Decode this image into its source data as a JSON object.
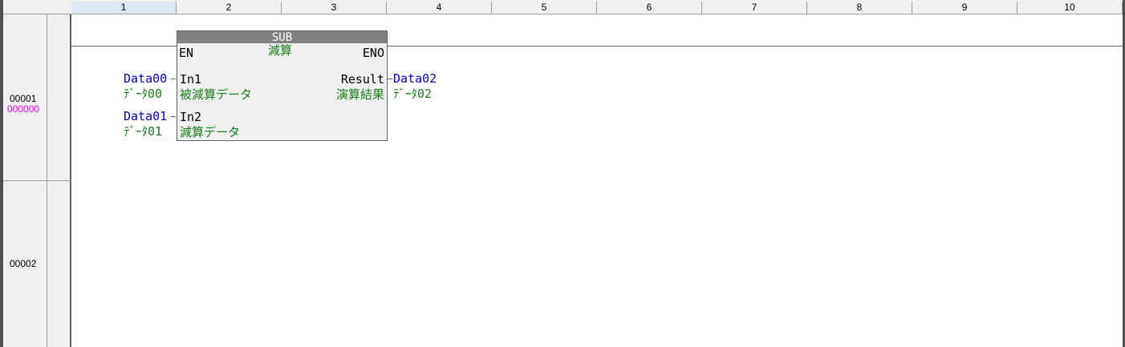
{
  "columns": [
    "1",
    "2",
    "3",
    "4",
    "5",
    "6",
    "7",
    "8",
    "9",
    "10"
  ],
  "selected_column": "1",
  "rows": [
    {
      "number": "00001",
      "step": "000000"
    },
    {
      "number": "00002"
    }
  ],
  "block": {
    "title": "SUB",
    "comment": "減算",
    "en": "EN",
    "eno": "ENO",
    "in1": {
      "name": "In1",
      "comment": "被減算データ",
      "var": "Data00",
      "var_comment": "ﾃﾞｰﾀ00"
    },
    "in2": {
      "name": "In2",
      "comment": "減算データ",
      "var": "Data01",
      "var_comment": "ﾃﾞｰﾀ01"
    },
    "out": {
      "name": "Result",
      "comment": "演算結果",
      "var": "Data02",
      "var_comment": "ﾃﾞｰﾀ02"
    }
  },
  "colors": {
    "variable": "#0000cc",
    "comment": "#1a7a1a",
    "step": "#ff00ff",
    "block_title_bg": "#808080"
  }
}
